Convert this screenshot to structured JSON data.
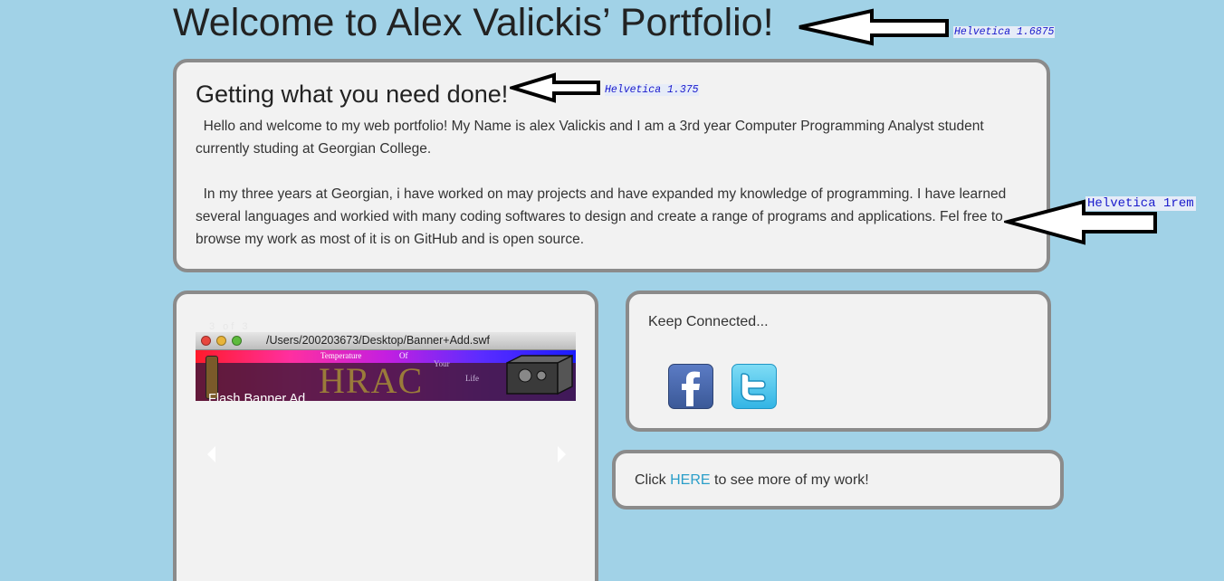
{
  "header": {
    "title": "Welcome to Alex Valickis’ Portfolio!"
  },
  "intro": {
    "heading": "Getting what you need done!",
    "paragraph1": "  Hello and welcome to my web portfolio! My Name is alex Valickis and I am a 3rd year Computer Programming Analyst student currently studing at Georgian College.",
    "paragraph2": "  In my three years at Georgian, i have worked on may projects and have expanded my knowledge of programming. I have learned several languages and workied with many coding softwares to design and create a range of programs and applications. Fel free to browse my work as most of it is on GitHub and is open source."
  },
  "slider": {
    "counter": "3 of 3",
    "window_path": "/Users/200203673/Desktop/Banner+Add.swf",
    "banner_words": [
      "Temperature",
      "Of",
      "Your",
      "Life"
    ],
    "banner_logo_text": "HRAC",
    "caption": "Flash Banner Ad",
    "prev_icon": "chevron-left-icon",
    "next_icon": "chevron-right-icon"
  },
  "social": {
    "title": "Keep Connected...",
    "links": [
      {
        "name": "facebook",
        "icon": "facebook-icon",
        "color": "#3b5998"
      },
      {
        "name": "twitter",
        "icon": "twitter-icon",
        "color": "#33b5e5"
      }
    ]
  },
  "more_work": {
    "prefix": "Click ",
    "link_text": "HERE",
    "suffix": " to see more of my work!",
    "link_color": "#2a9ec9"
  },
  "annotations": {
    "title_font": "Helvetica 1.6875",
    "heading_font": "Helvetica 1.375",
    "body_font": "Helvetica 1rem"
  },
  "colors": {
    "background": "#a1d2e7",
    "panel": "#f2f2f2",
    "panel_border": "#8b8b8b"
  }
}
